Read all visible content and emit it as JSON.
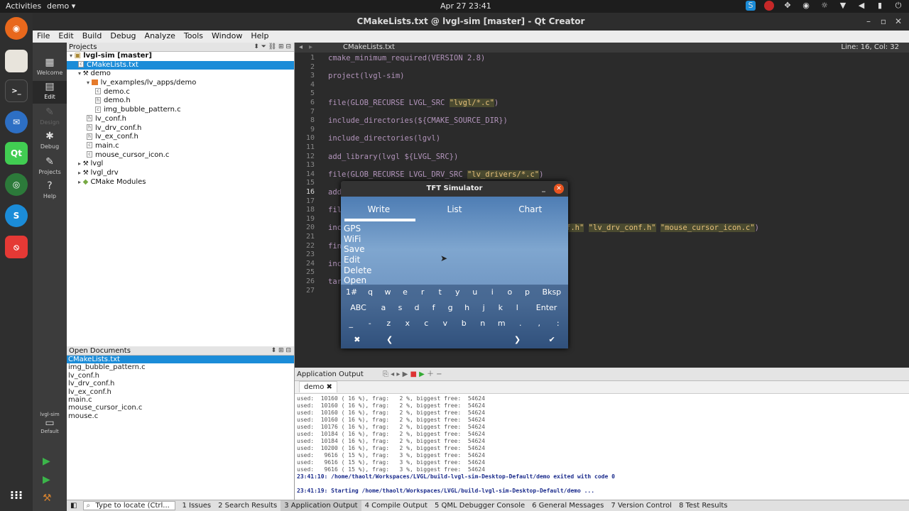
{
  "topbar": {
    "activities": "Activities",
    "app": "demo ▾",
    "clock": "Apr 27  23:41"
  },
  "window": {
    "title": "CMakeLists.txt @ lvgl-sim [master] - Qt Creator"
  },
  "menu": [
    "File",
    "Edit",
    "Build",
    "Debug",
    "Analyze",
    "Tools",
    "Window",
    "Help"
  ],
  "modes": [
    {
      "label": "Welcome",
      "glyph": "▦"
    },
    {
      "label": "Edit",
      "glyph": "▤"
    },
    {
      "label": "Design",
      "glyph": "✎"
    },
    {
      "label": "Debug",
      "glyph": "✱"
    },
    {
      "label": "Projects",
      "glyph": "✎"
    },
    {
      "label": "Help",
      "glyph": "?"
    }
  ],
  "kit": {
    "project": "lvgl-sim",
    "config": "Default"
  },
  "projects": {
    "header": "Projects",
    "items": [
      {
        "label": "lvgl-sim [master]",
        "indent": 0,
        "kind": "root"
      },
      {
        "label": "CMakeLists.txt",
        "indent": 1,
        "kind": "file",
        "selected": true
      },
      {
        "label": "demo",
        "indent": 1,
        "kind": "target"
      },
      {
        "label": "lv_examples/lv_apps/demo",
        "indent": 2,
        "kind": "folder"
      },
      {
        "label": "demo.c",
        "indent": 3,
        "kind": "file"
      },
      {
        "label": "demo.h",
        "indent": 3,
        "kind": "file"
      },
      {
        "label": "img_bubble_pattern.c",
        "indent": 3,
        "kind": "file"
      },
      {
        "label": "lv_conf.h",
        "indent": 2,
        "kind": "file"
      },
      {
        "label": "lv_drv_conf.h",
        "indent": 2,
        "kind": "file"
      },
      {
        "label": "lv_ex_conf.h",
        "indent": 2,
        "kind": "file"
      },
      {
        "label": "main.c",
        "indent": 2,
        "kind": "file"
      },
      {
        "label": "mouse_cursor_icon.c",
        "indent": 2,
        "kind": "file"
      },
      {
        "label": "lvgl",
        "indent": 1,
        "kind": "target"
      },
      {
        "label": "lvgl_drv",
        "indent": 1,
        "kind": "target"
      },
      {
        "label": "CMake Modules",
        "indent": 1,
        "kind": "module"
      }
    ]
  },
  "open_documents": {
    "header": "Open Documents",
    "items": [
      "CMakeLists.txt",
      "img_bubble_pattern.c",
      "lv_conf.h",
      "lv_drv_conf.h",
      "lv_ex_conf.h",
      "main.c",
      "mouse_cursor_icon.c",
      "mouse.c"
    ]
  },
  "editor": {
    "file": "CMakeLists.txt",
    "position": "Line: 16, Col: 32",
    "lines": [
      "cmake_minimum_required(VERSION 2.8)",
      "",
      "project(lvgl-sim)",
      "",
      "",
      "file(GLOB_RECURSE LVGL_SRC \"lvgl/*.c\")",
      "",
      "include_directories(${CMAKE_SOURCE_DIR})",
      "",
      "include_directories(lgvl)",
      "",
      "add_library(lvgl ${LVGL_SRC})",
      "",
      "file(GLOB_RECURSE LVGL_DRV_SRC \"lv_drivers/*.c\")",
      "",
      "add",
      "",
      "fil                                        \"*.[ch]\")",
      "",
      "inc                                        \"lv_ex_conf.h\" \"lv_drv_conf.h\" \"mouse_cursor_icon.c\")",
      "",
      "fin",
      "",
      "inc",
      "",
      "tar                                        ARIES})",
      ""
    ]
  },
  "simulator": {
    "title": "TFT Simulator",
    "tabs": [
      "Write",
      "List",
      "Chart"
    ],
    "list": [
      "GPS",
      "WiFi",
      "Save",
      "Edit",
      "Delete",
      "Open"
    ],
    "keys_row1": [
      "1#",
      "q",
      "w",
      "e",
      "r",
      "t",
      "y",
      "u",
      "i",
      "o",
      "p",
      "Bksp"
    ],
    "keys_row2": [
      "ABC",
      "a",
      "s",
      "d",
      "f",
      "g",
      "h",
      "j",
      "k",
      "l",
      "Enter"
    ],
    "keys_row3": [
      "_",
      "-",
      "z",
      "x",
      "c",
      "v",
      "b",
      "n",
      "m",
      ".",
      ",",
      ":"
    ],
    "keys_row4": [
      "✖",
      "❮",
      "",
      "❯",
      "✔"
    ]
  },
  "app_output": {
    "header": "Application Output",
    "tab": "demo ✖",
    "lines": [
      "used:  10160 ( 16 %), frag:   2 %, biggest free:  54624",
      "used:  10160 ( 16 %), frag:   2 %, biggest free:  54624",
      "used:  10160 ( 16 %), frag:   2 %, biggest free:  54624",
      "used:  10160 ( 16 %), frag:   2 %, biggest free:  54624",
      "used:  10176 ( 16 %), frag:   2 %, biggest free:  54624",
      "used:  10184 ( 16 %), frag:   2 %, biggest free:  54624",
      "used:  10184 ( 16 %), frag:   2 %, biggest free:  54624",
      "used:  10200 ( 16 %), frag:   2 %, biggest free:  54624",
      "used:   9616 ( 15 %), frag:   3 %, biggest free:  54624",
      "used:   9616 ( 15 %), frag:   3 %, biggest free:  54624",
      "used:   9616 ( 15 %), frag:   3 %, biggest free:  54624",
      "23:41:10: /home/thaolt/Workspaces/LVGL/build-lvgl-sim-Desktop-Default/demo exited with code 0",
      "",
      "23:41:19: Starting /home/thaolt/Workspaces/LVGL/build-lvgl-sim-Desktop-Default/demo ..."
    ]
  },
  "statusbar": {
    "locate_placeholder": "Type to locate (Ctrl...",
    "items": [
      "1 Issues",
      "2 Search Results",
      "3 Application Output",
      "4 Compile Output",
      "5 QML Debugger Console",
      "6 General Messages",
      "7 Version Control",
      "8 Test Results"
    ]
  }
}
